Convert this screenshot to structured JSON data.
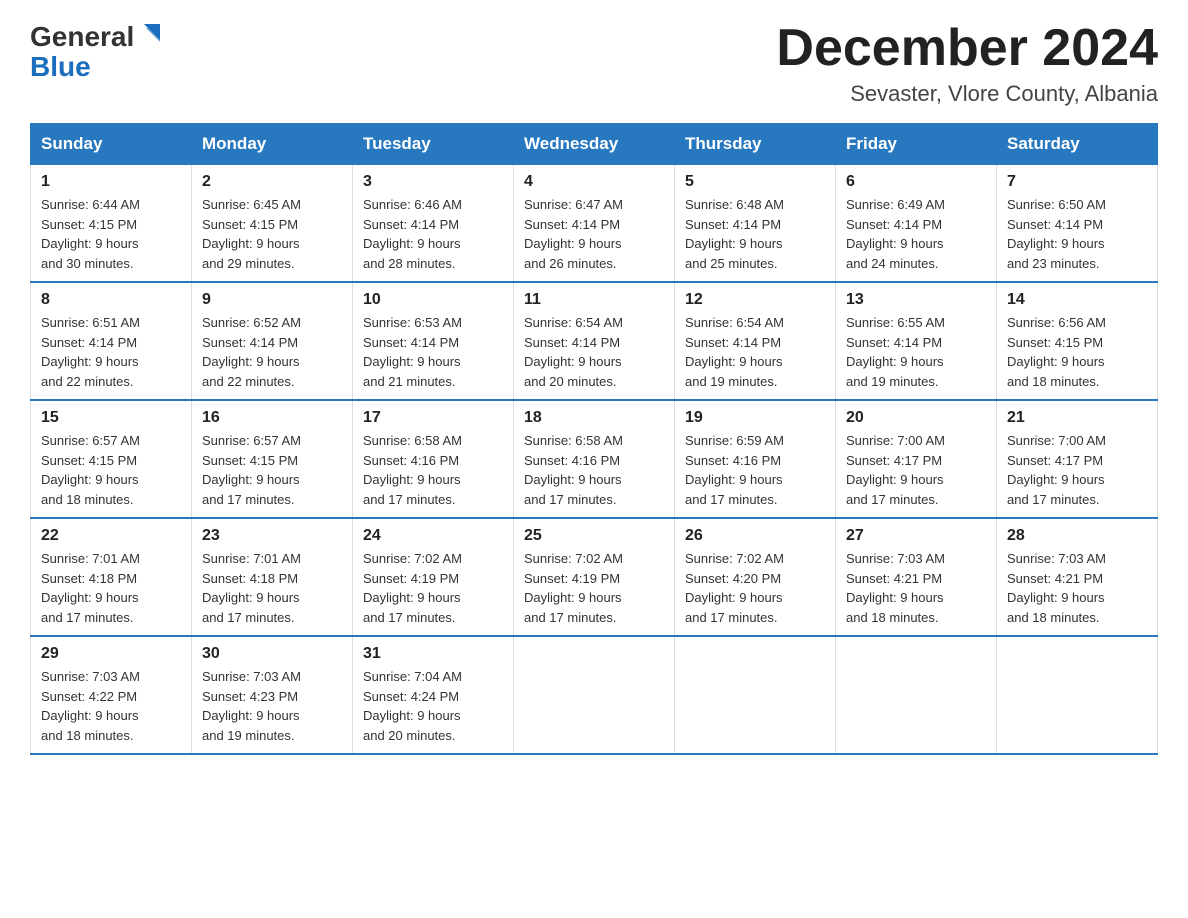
{
  "header": {
    "logo_general": "General",
    "logo_blue": "Blue",
    "month_year": "December 2024",
    "location": "Sevaster, Vlore County, Albania"
  },
  "days_of_week": [
    "Sunday",
    "Monday",
    "Tuesday",
    "Wednesday",
    "Thursday",
    "Friday",
    "Saturday"
  ],
  "weeks": [
    [
      {
        "num": "1",
        "sunrise": "6:44 AM",
        "sunset": "4:15 PM",
        "daylight": "9 hours and 30 minutes."
      },
      {
        "num": "2",
        "sunrise": "6:45 AM",
        "sunset": "4:15 PM",
        "daylight": "9 hours and 29 minutes."
      },
      {
        "num": "3",
        "sunrise": "6:46 AM",
        "sunset": "4:14 PM",
        "daylight": "9 hours and 28 minutes."
      },
      {
        "num": "4",
        "sunrise": "6:47 AM",
        "sunset": "4:14 PM",
        "daylight": "9 hours and 26 minutes."
      },
      {
        "num": "5",
        "sunrise": "6:48 AM",
        "sunset": "4:14 PM",
        "daylight": "9 hours and 25 minutes."
      },
      {
        "num": "6",
        "sunrise": "6:49 AM",
        "sunset": "4:14 PM",
        "daylight": "9 hours and 24 minutes."
      },
      {
        "num": "7",
        "sunrise": "6:50 AM",
        "sunset": "4:14 PM",
        "daylight": "9 hours and 23 minutes."
      }
    ],
    [
      {
        "num": "8",
        "sunrise": "6:51 AM",
        "sunset": "4:14 PM",
        "daylight": "9 hours and 22 minutes."
      },
      {
        "num": "9",
        "sunrise": "6:52 AM",
        "sunset": "4:14 PM",
        "daylight": "9 hours and 22 minutes."
      },
      {
        "num": "10",
        "sunrise": "6:53 AM",
        "sunset": "4:14 PM",
        "daylight": "9 hours and 21 minutes."
      },
      {
        "num": "11",
        "sunrise": "6:54 AM",
        "sunset": "4:14 PM",
        "daylight": "9 hours and 20 minutes."
      },
      {
        "num": "12",
        "sunrise": "6:54 AM",
        "sunset": "4:14 PM",
        "daylight": "9 hours and 19 minutes."
      },
      {
        "num": "13",
        "sunrise": "6:55 AM",
        "sunset": "4:14 PM",
        "daylight": "9 hours and 19 minutes."
      },
      {
        "num": "14",
        "sunrise": "6:56 AM",
        "sunset": "4:15 PM",
        "daylight": "9 hours and 18 minutes."
      }
    ],
    [
      {
        "num": "15",
        "sunrise": "6:57 AM",
        "sunset": "4:15 PM",
        "daylight": "9 hours and 18 minutes."
      },
      {
        "num": "16",
        "sunrise": "6:57 AM",
        "sunset": "4:15 PM",
        "daylight": "9 hours and 17 minutes."
      },
      {
        "num": "17",
        "sunrise": "6:58 AM",
        "sunset": "4:16 PM",
        "daylight": "9 hours and 17 minutes."
      },
      {
        "num": "18",
        "sunrise": "6:58 AM",
        "sunset": "4:16 PM",
        "daylight": "9 hours and 17 minutes."
      },
      {
        "num": "19",
        "sunrise": "6:59 AM",
        "sunset": "4:16 PM",
        "daylight": "9 hours and 17 minutes."
      },
      {
        "num": "20",
        "sunrise": "7:00 AM",
        "sunset": "4:17 PM",
        "daylight": "9 hours and 17 minutes."
      },
      {
        "num": "21",
        "sunrise": "7:00 AM",
        "sunset": "4:17 PM",
        "daylight": "9 hours and 17 minutes."
      }
    ],
    [
      {
        "num": "22",
        "sunrise": "7:01 AM",
        "sunset": "4:18 PM",
        "daylight": "9 hours and 17 minutes."
      },
      {
        "num": "23",
        "sunrise": "7:01 AM",
        "sunset": "4:18 PM",
        "daylight": "9 hours and 17 minutes."
      },
      {
        "num": "24",
        "sunrise": "7:02 AM",
        "sunset": "4:19 PM",
        "daylight": "9 hours and 17 minutes."
      },
      {
        "num": "25",
        "sunrise": "7:02 AM",
        "sunset": "4:19 PM",
        "daylight": "9 hours and 17 minutes."
      },
      {
        "num": "26",
        "sunrise": "7:02 AM",
        "sunset": "4:20 PM",
        "daylight": "9 hours and 17 minutes."
      },
      {
        "num": "27",
        "sunrise": "7:03 AM",
        "sunset": "4:21 PM",
        "daylight": "9 hours and 18 minutes."
      },
      {
        "num": "28",
        "sunrise": "7:03 AM",
        "sunset": "4:21 PM",
        "daylight": "9 hours and 18 minutes."
      }
    ],
    [
      {
        "num": "29",
        "sunrise": "7:03 AM",
        "sunset": "4:22 PM",
        "daylight": "9 hours and 18 minutes."
      },
      {
        "num": "30",
        "sunrise": "7:03 AM",
        "sunset": "4:23 PM",
        "daylight": "9 hours and 19 minutes."
      },
      {
        "num": "31",
        "sunrise": "7:04 AM",
        "sunset": "4:24 PM",
        "daylight": "9 hours and 20 minutes."
      },
      null,
      null,
      null,
      null
    ]
  ],
  "labels": {
    "sunrise": "Sunrise:",
    "sunset": "Sunset:",
    "daylight": "Daylight:"
  }
}
